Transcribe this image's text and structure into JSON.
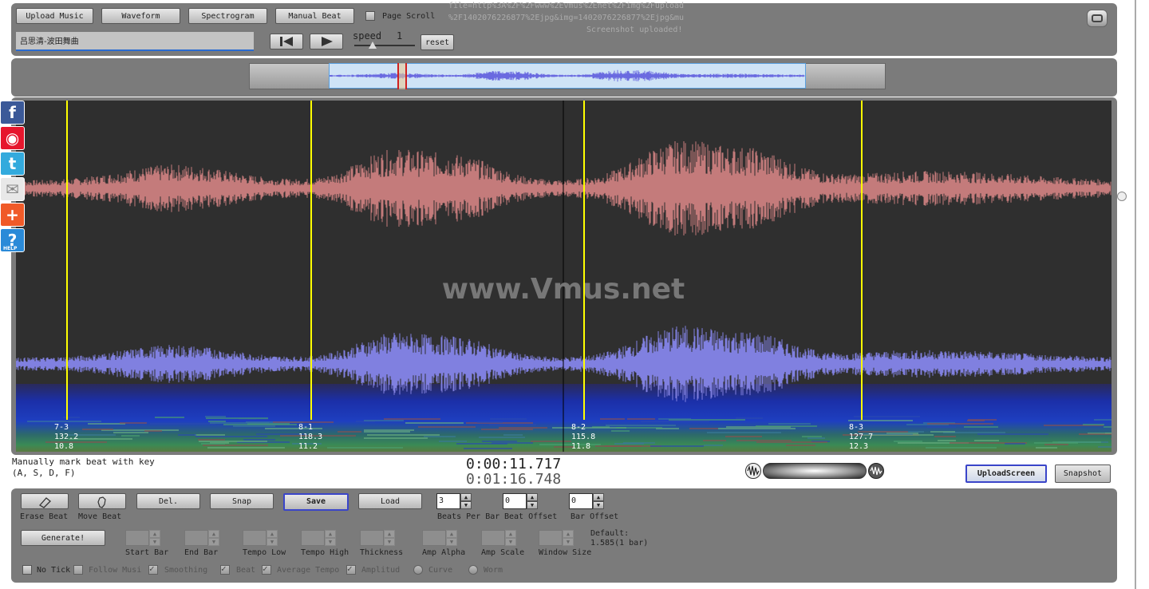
{
  "toolbar": {
    "upload_music": "Upload Music",
    "waveform": "Waveform",
    "spectrogram": "Spectrogram",
    "manual_beat": "Manual Beat",
    "page_scroll": "Page Scroll",
    "status_line1": "file=http%3A%2F%2Fwww%2Evmus%2Enet%2Fimg%2Fupload",
    "status_line2": "%2F1402076226877%2Ejpg&img=1402076226877%2Ejpg&mu",
    "status_line3": "Screenshot uploaded!",
    "song_title": "吕思清-波田舞曲",
    "speed_label": "speed",
    "speed_value": "1",
    "reset": "reset"
  },
  "main_view": {
    "watermark": "www.Vmus.net",
    "beats": [
      {
        "bar": "7-3",
        "tempo": "132.2",
        "time": "10.8"
      },
      {
        "bar": "8-1",
        "tempo": "118.3",
        "time": "11.2"
      },
      {
        "bar": "8-2",
        "tempo": "115.8",
        "time": "11.8"
      },
      {
        "bar": "8-3",
        "tempo": "127.7",
        "time": "12.3"
      }
    ],
    "waveform_color": "#c47b7b",
    "waveform2_color": "#8080e0",
    "beat_line_color": "#ffff00"
  },
  "status": {
    "hint_line1": "Manually mark beat with key",
    "hint_line2": "(A, S, D, F)",
    "current_time": "0:00:11.717",
    "total_time": "0:01:16.748",
    "upload_screen": "UploadScreen",
    "snapshot": "Snapshot"
  },
  "controls": {
    "erase_beat": "Erase Beat",
    "move_beat": "Move Beat",
    "del": "Del.",
    "snap": "Snap",
    "save": "Save",
    "load": "Load",
    "beats_per_bar_value": "3",
    "beats_per_bar_label": "Beats Per Bar",
    "beat_offset_value": "0",
    "beat_offset_label": "Beat Offset",
    "bar_offset_value": "0",
    "bar_offset_label": "Bar Offset",
    "generate": "Generate!",
    "start_bar": "Start Bar",
    "end_bar": "End Bar",
    "tempo_low": "Tempo Low",
    "tempo_high": "Tempo High",
    "thickness": "Thickness",
    "amp_alpha": "Amp Alpha",
    "amp_scale": "Amp Scale",
    "window_size": "Window Size",
    "default_line1": "Default:",
    "default_line2": "1.585(1 bar)",
    "no_tick": "No Tick",
    "follow_music": "Follow Musi",
    "smoothing": "Smoothing",
    "beat": "Beat",
    "average_tempo": "Average Tempo",
    "amplitude": "Amplitud",
    "curve": "Curve",
    "worm": "Worm"
  },
  "social": [
    "facebook-icon",
    "weibo-icon",
    "twitter-icon",
    "mail-icon",
    "add-icon",
    "help-icon"
  ],
  "social_help_text": "HELP"
}
